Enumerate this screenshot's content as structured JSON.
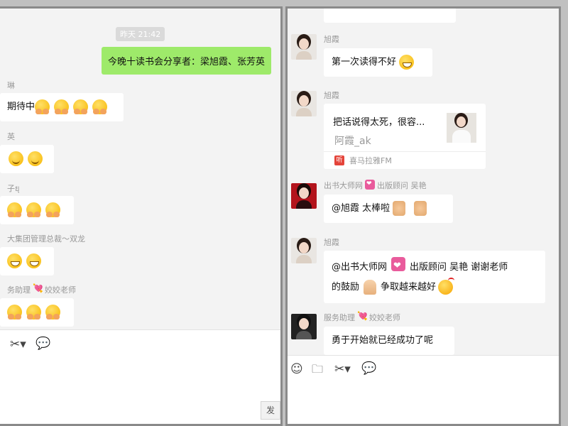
{
  "left": {
    "timestamp": "昨天 21:42",
    "sent_message": "今晚十读书会分享者：梁旭霞、张芳英",
    "messages": [
      {
        "sender": "琳",
        "text": "期待中",
        "emoji": [
          "hugging-face",
          "hugging-face",
          "hugging-face",
          "hugging-face"
        ]
      },
      {
        "sender": "英",
        "text": "",
        "emoji": [
          "smile",
          "smile"
        ]
      },
      {
        "sender": "子ยุ",
        "text": "",
        "emoji": [
          "hugging-face",
          "hugging-face",
          "hugging-face"
        ]
      },
      {
        "sender": "大集团管理总裁～双龙",
        "text": "",
        "emoji": [
          "grin-blush",
          "grin-blush"
        ]
      },
      {
        "sender_prefix": "务助理",
        "sender_suffix": "姣姣老师",
        "text": "",
        "emoji": [
          "hugging-face",
          "hugging-face",
          "hugging-face"
        ]
      }
    ],
    "send_label": "发"
  },
  "right": {
    "messages": [
      {
        "sender": "旭霞",
        "text": "第一次读得不好"
      },
      {
        "sender": "旭霞",
        "card": {
          "title": "把话说得太死，很容...",
          "author": "阿霞_ak",
          "source": "喜马拉雅FM",
          "source_icon_text": "听"
        }
      },
      {
        "sender_prefix": "出书大师网",
        "sender_suffix": "出版顾问 吴艳",
        "text": "@旭霞 太棒啦"
      },
      {
        "sender": "旭霞",
        "line1_a": "@出书大师网",
        "line1_b": "出版顾问 吴艳 谢谢老师",
        "line2": "的鼓励",
        "line2_b": "争取越来越好"
      },
      {
        "sender_prefix": "服务助理",
        "sender_suffix": "姣姣老师",
        "text": "勇于开始就已经成功了呢"
      }
    ]
  },
  "icons": {
    "emoji": "emoji-icon",
    "folder": "folder-icon",
    "scissors": "scissors-icon",
    "chat": "chat-bubble-icon"
  }
}
